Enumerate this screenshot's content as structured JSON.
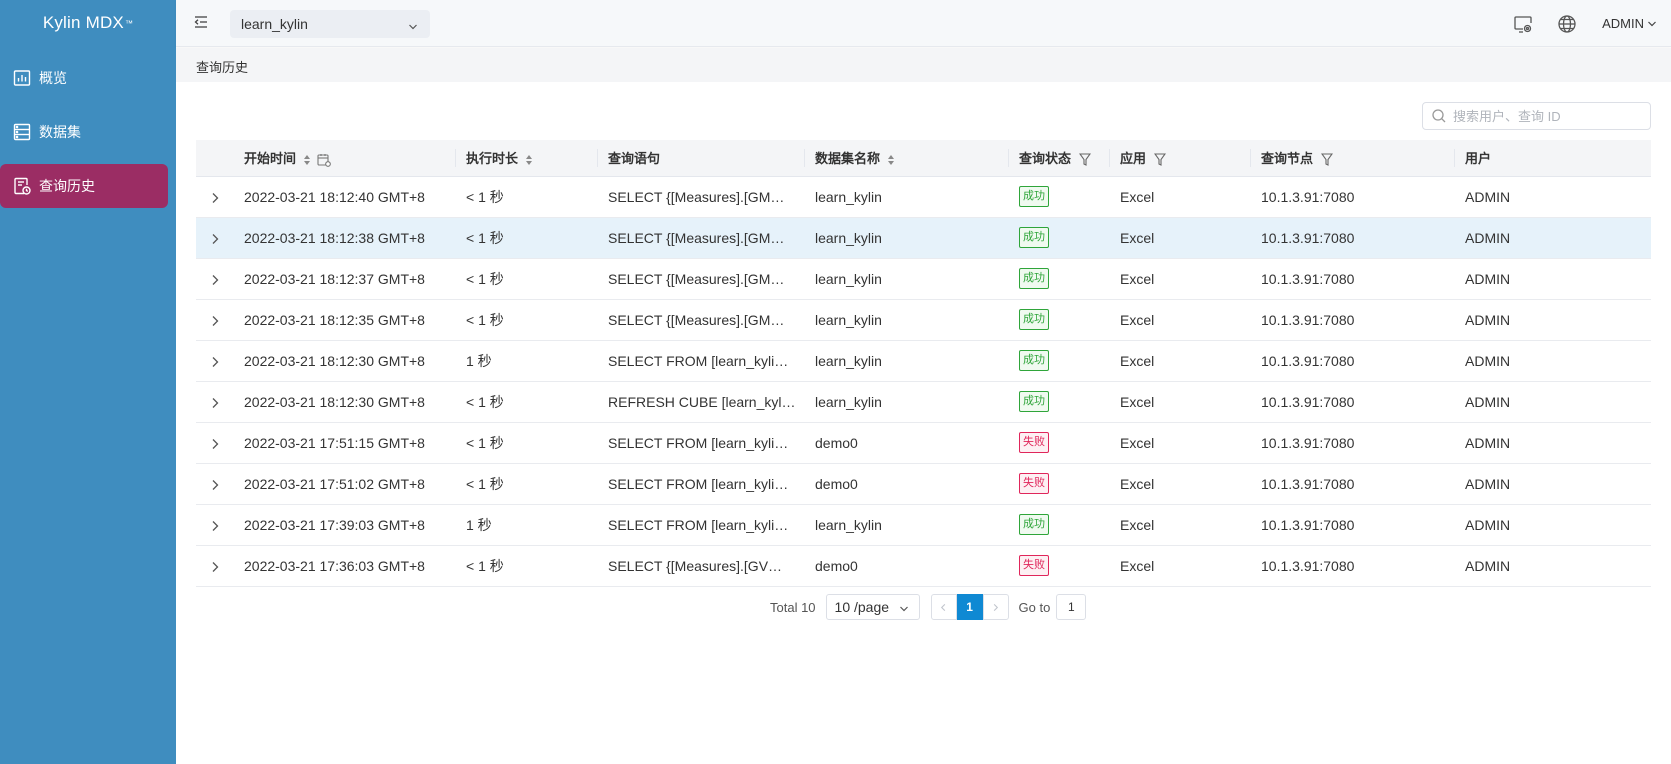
{
  "app": {
    "logo_text": "Kylin MDX",
    "logo_mark": "™"
  },
  "sidebar": {
    "items": [
      {
        "label": "概览",
        "icon": "chart-icon",
        "active": false
      },
      {
        "label": "数据集",
        "icon": "dataset-icon",
        "active": false
      },
      {
        "label": "查询历史",
        "icon": "query-history-icon",
        "active": true
      }
    ],
    "background": "#3f8dbf",
    "active_color": "#9b2d64"
  },
  "header": {
    "project": "learn_kylin",
    "user": "ADMIN"
  },
  "breadcrumb": "查询历史",
  "search": {
    "placeholder": "搜索用户、查询 ID",
    "value": ""
  },
  "table": {
    "columns": {
      "start_time": "开始时间",
      "duration": "执行时长",
      "query": "查询语句",
      "dataset": "数据集名称",
      "status": "查询状态",
      "app": "应用",
      "node": "查询节点",
      "user": "用户"
    },
    "rows": [
      {
        "start_time": "2022-03-21 18:12:40 GMT+8",
        "duration": "< 1 秒",
        "query": "SELECT {[Measures].[GM…",
        "dataset": "learn_kylin",
        "status": "成功",
        "ok": true,
        "app": "Excel",
        "node": "10.1.3.91:7080",
        "user": "ADMIN"
      },
      {
        "start_time": "2022-03-21 18:12:38 GMT+8",
        "duration": "< 1 秒",
        "query": "SELECT {[Measures].[GM…",
        "dataset": "learn_kylin",
        "status": "成功",
        "ok": true,
        "app": "Excel",
        "node": "10.1.3.91:7080",
        "user": "ADMIN"
      },
      {
        "start_time": "2022-03-21 18:12:37 GMT+8",
        "duration": "< 1 秒",
        "query": "SELECT {[Measures].[GM…",
        "dataset": "learn_kylin",
        "status": "成功",
        "ok": true,
        "app": "Excel",
        "node": "10.1.3.91:7080",
        "user": "ADMIN"
      },
      {
        "start_time": "2022-03-21 18:12:35 GMT+8",
        "duration": "< 1 秒",
        "query": "SELECT {[Measures].[GM…",
        "dataset": "learn_kylin",
        "status": "成功",
        "ok": true,
        "app": "Excel",
        "node": "10.1.3.91:7080",
        "user": "ADMIN"
      },
      {
        "start_time": "2022-03-21 18:12:30 GMT+8",
        "duration": "1 秒",
        "query": "SELECT FROM [learn_kyli…",
        "dataset": "learn_kylin",
        "status": "成功",
        "ok": true,
        "app": "Excel",
        "node": "10.1.3.91:7080",
        "user": "ADMIN"
      },
      {
        "start_time": "2022-03-21 18:12:30 GMT+8",
        "duration": "< 1 秒",
        "query": "REFRESH CUBE [learn_kyl…",
        "dataset": "learn_kylin",
        "status": "成功",
        "ok": true,
        "app": "Excel",
        "node": "10.1.3.91:7080",
        "user": "ADMIN"
      },
      {
        "start_time": "2022-03-21 17:51:15 GMT+8",
        "duration": "< 1 秒",
        "query": "SELECT FROM [learn_kyli…",
        "dataset": "demo0",
        "status": "失败",
        "ok": false,
        "app": "Excel",
        "node": "10.1.3.91:7080",
        "user": "ADMIN"
      },
      {
        "start_time": "2022-03-21 17:51:02 GMT+8",
        "duration": "< 1 秒",
        "query": "SELECT FROM [learn_kyli…",
        "dataset": "demo0",
        "status": "失败",
        "ok": false,
        "app": "Excel",
        "node": "10.1.3.91:7080",
        "user": "ADMIN"
      },
      {
        "start_time": "2022-03-21 17:39:03 GMT+8",
        "duration": "1 秒",
        "query": "SELECT FROM [learn_kyli…",
        "dataset": "learn_kylin",
        "status": "成功",
        "ok": true,
        "app": "Excel",
        "node": "10.1.3.91:7080",
        "user": "ADMIN"
      },
      {
        "start_time": "2022-03-21 17:36:03 GMT+8",
        "duration": "< 1 秒",
        "query": "SELECT {[Measures].[GV…",
        "dataset": "demo0",
        "status": "失败",
        "ok": false,
        "app": "Excel",
        "node": "10.1.3.91:7080",
        "user": "ADMIN"
      }
    ],
    "highlighted_row": 1
  },
  "pagination": {
    "total": "Total 10",
    "page_size": "10 /page",
    "current_page": "1",
    "goto_label": "Go to",
    "goto_value": "1"
  },
  "colors": {
    "success": "#2fa53a",
    "fail": "#e0265b",
    "accent": "#0f89d3"
  }
}
